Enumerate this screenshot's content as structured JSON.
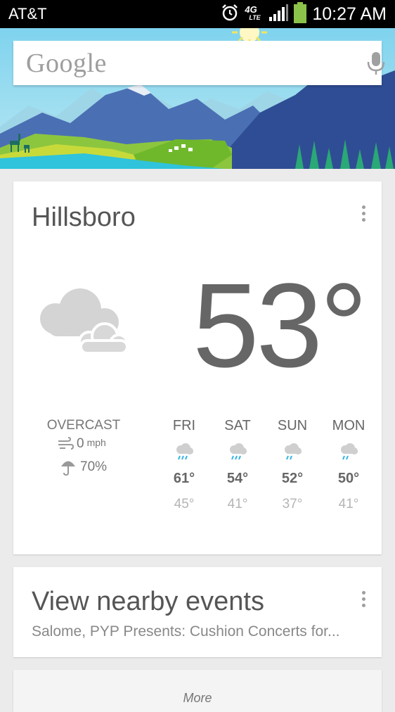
{
  "status_bar": {
    "carrier": "AT&T",
    "network": "4G",
    "network_sub": "LTE",
    "time": "10:27 AM",
    "battery_color": "#8bc34a"
  },
  "search": {
    "logo": "Google",
    "mic_icon": "mic-icon"
  },
  "weather": {
    "city": "Hillsboro",
    "temperature": "53°",
    "condition": "OVERCAST",
    "wind_value": "0",
    "wind_unit": "mph",
    "rain_chance": "70%",
    "forecast": [
      {
        "day": "FRI",
        "high": "61°",
        "low": "45°",
        "icon": "rain-cloud-icon"
      },
      {
        "day": "SAT",
        "high": "54°",
        "low": "41°",
        "icon": "rain-cloud-icon"
      },
      {
        "day": "SUN",
        "high": "52°",
        "low": "37°",
        "icon": "rain-cloud-icon"
      },
      {
        "day": "MON",
        "high": "50°",
        "low": "41°",
        "icon": "rain-cloud-icon"
      }
    ]
  },
  "events": {
    "title": "View nearby events",
    "subtitle": "Salome, PYP Presents: Cushion Concerts for..."
  },
  "more": {
    "label": "More"
  },
  "colors": {
    "accent_blue": "#33b5e5",
    "card_bg": "#ffffff",
    "page_bg": "#ebebeb"
  }
}
